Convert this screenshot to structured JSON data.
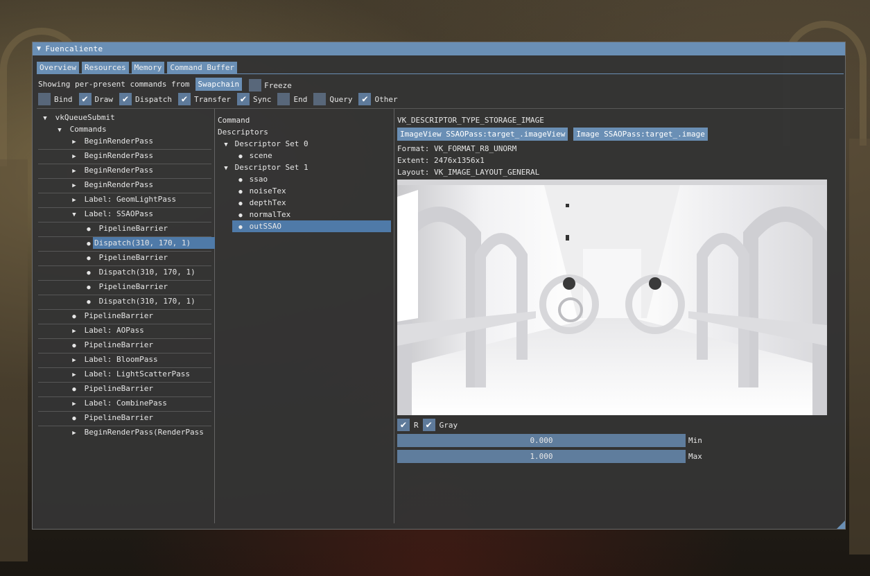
{
  "window": {
    "title": "Fuencaliente"
  },
  "tabs": [
    {
      "label": "Overview"
    },
    {
      "label": "Resources"
    },
    {
      "label": "Memory"
    },
    {
      "label": "Command Buffer"
    }
  ],
  "showing": {
    "text": "Showing per-present commands from",
    "source_button": "Swapchain",
    "freeze_label": "Freeze",
    "freeze_checked": false
  },
  "filters": [
    {
      "label": "Bind",
      "checked": false
    },
    {
      "label": "Draw",
      "checked": true
    },
    {
      "label": "Dispatch",
      "checked": true
    },
    {
      "label": "Transfer",
      "checked": true
    },
    {
      "label": "Sync",
      "checked": true
    },
    {
      "label": "End",
      "checked": false
    },
    {
      "label": "Query",
      "checked": false
    },
    {
      "label": "Other",
      "checked": true
    }
  ],
  "tree": {
    "root": "vkQueueSubmit",
    "commands": "Commands",
    "items": [
      "BeginRenderPass",
      "BeginRenderPass",
      "BeginRenderPass",
      "BeginRenderPass",
      "Label: GeomLightPass",
      "Label: SSAOPass",
      "PipelineBarrier",
      "Dispatch(310, 170, 1)",
      "PipelineBarrier",
      "Dispatch(310, 170, 1)",
      "PipelineBarrier",
      "Dispatch(310, 170, 1)",
      "PipelineBarrier",
      "Label: AOPass",
      "PipelineBarrier",
      "Label: BloomPass",
      "Label: LightScatterPass",
      "PipelineBarrier",
      "Label: CombinePass",
      "PipelineBarrier",
      "BeginRenderPass(RenderPass"
    ],
    "selected": "Dispatch(310, 170, 1)"
  },
  "descriptors": {
    "command": "Command",
    "header": "Descriptors",
    "set0": "Descriptor Set 0",
    "set0_items": [
      "scene"
    ],
    "set1": "Descriptor Set 1",
    "set1_items": [
      "ssao",
      "noiseTex",
      "depthTex",
      "normalTex",
      "outSSAO"
    ],
    "selected": "outSSAO"
  },
  "detail": {
    "type": "VK_DESCRIPTOR_TYPE_STORAGE_IMAGE",
    "image_view_button": "ImageView SSAOPass:target_.imageView",
    "image_button": "Image SSAOPass:target_.image",
    "format": "Format: VK_FORMAT_R8_UNORM",
    "extent": "Extent: 2476x1356x1",
    "layout": "Layout: VK_IMAGE_LAYOUT_GENERAL",
    "channel_r": "R",
    "channel_r_checked": true,
    "gray": "Gray",
    "gray_checked": true,
    "min_value": "0.000",
    "min_label": "Min",
    "max_value": "1.000",
    "max_label": "Max"
  },
  "colors": {
    "accent": "#6a8fb5",
    "selection": "#4f7aa8",
    "window_bg": "#343434"
  }
}
